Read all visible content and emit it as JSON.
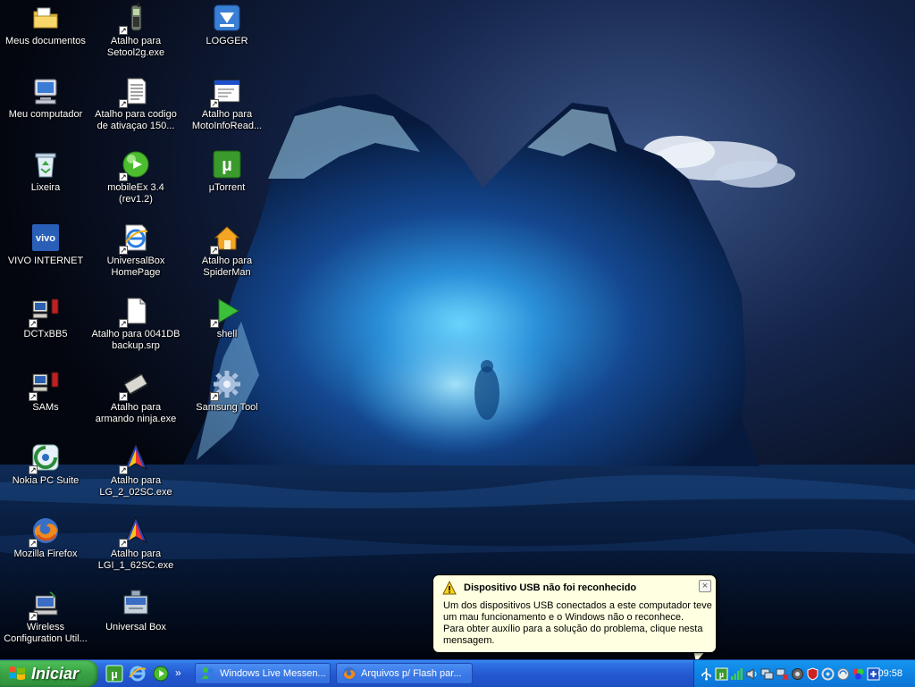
{
  "desktop": {
    "icons": [
      {
        "label": "Meus documentos",
        "icon": "my-documents-icon",
        "shortcut": false
      },
      {
        "label": "Atalho para Setool2g.exe",
        "icon": "phone-tool-icon",
        "shortcut": true
      },
      {
        "label": "LOGGER",
        "icon": "logger-icon",
        "shortcut": false
      },
      {
        "label": "Meu computador",
        "icon": "my-computer-icon",
        "shortcut": false
      },
      {
        "label": "Atalho para codigo de ativaçao 150...",
        "icon": "text-document-icon",
        "shortcut": true
      },
      {
        "label": "Atalho para MotoInfoRead...",
        "icon": "application-window-icon",
        "shortcut": true
      },
      {
        "label": "Lixeira",
        "icon": "recycle-bin-icon",
        "shortcut": false
      },
      {
        "label": "mobileEx 3.4 (rev1.2)",
        "icon": "green-ball-icon",
        "shortcut": true
      },
      {
        "label": "µTorrent",
        "icon": "utorrent-icon",
        "shortcut": false
      },
      {
        "label": "VIVO INTERNET",
        "icon": "vivo-icon",
        "shortcut": false
      },
      {
        "label": "UniversalBox HomePage",
        "icon": "internet-explorer-icon",
        "shortcut": true
      },
      {
        "label": "Atalho para SpiderMan",
        "icon": "house-icon",
        "shortcut": true
      },
      {
        "label": "DCTxBB5",
        "icon": "pc-connect-icon",
        "shortcut": true
      },
      {
        "label": "Atalho para 0041DB backup.srp",
        "icon": "blank-file-icon",
        "shortcut": true
      },
      {
        "label": "shell",
        "icon": "play-arrow-icon",
        "shortcut": true
      },
      {
        "label": "SAMs",
        "icon": "pc-connect-icon",
        "shortcut": true
      },
      {
        "label": "Atalho para armando ninja.exe",
        "icon": "chip-icon",
        "shortcut": true
      },
      {
        "label": "Samsung Tool",
        "icon": "gear-icon",
        "shortcut": true
      },
      {
        "label": "Nokia PC Suite",
        "icon": "nokia-suite-icon",
        "shortcut": true
      },
      {
        "label": "Atalho para LG_2_02SC.exe",
        "icon": "lg-flasher-icon",
        "shortcut": true
      },
      {
        "label": "Mozilla Firefox",
        "icon": "firefox-icon",
        "shortcut": true
      },
      {
        "label": "Atalho para LGI_1_62SC.exe",
        "icon": "lg-flasher-icon",
        "shortcut": true
      },
      {
        "label": "Wireless Configuration Util...",
        "icon": "wireless-config-icon",
        "shortcut": true
      },
      {
        "label": "Universal Box",
        "icon": "universal-box-icon",
        "shortcut": false
      }
    ]
  },
  "balloon": {
    "title": "Dispositivo USB não foi reconhecido",
    "close_label": "×",
    "lines": [
      "Um dos dispositivos USB conectados a este computador teve",
      "um mau funcionamento e o Windows não o reconhece.",
      "Para obter auxílio para a solução do problema, clique nesta",
      "mensagem."
    ]
  },
  "taskbar": {
    "start_label": "Iniciar",
    "quick_launch": [
      "utorrent-icon",
      "internet-explorer-icon",
      "green-ball-icon"
    ],
    "quick_launch_more": "»",
    "tasks": [
      {
        "label": "Windows Live Messen...",
        "icon": "messenger-icon"
      },
      {
        "label": "Arquivos p/ Flash par...",
        "icon": "firefox-icon"
      }
    ],
    "tray_icons": [
      "usb-device-icon",
      "utorrent-icon",
      "signal-bars-icon",
      "volume-icon",
      "network-icon",
      "network-disconnected-icon",
      "antivirus-icon",
      "security-shield-icon",
      "display-icon",
      "sync-icon",
      "bluetooth-icon",
      "update-icon"
    ],
    "clock": "09:58"
  }
}
